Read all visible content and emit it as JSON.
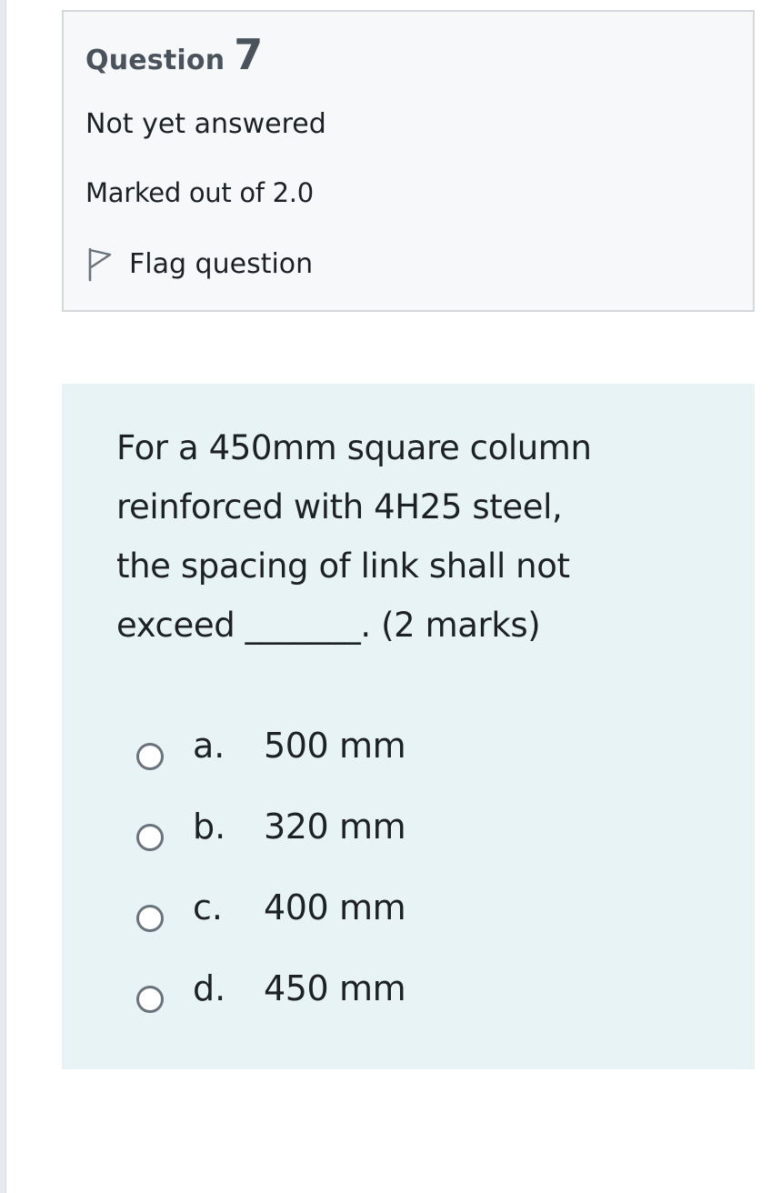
{
  "question": {
    "label": "Question",
    "number": "7",
    "state": "Not yet answered",
    "grade": "Marked out of 2.0",
    "flag_label": "Flag question",
    "flag_icon": "flag-outline-icon"
  },
  "content": {
    "lines": [
      "For a 450mm square column",
      "reinforced with 4H25 steel,",
      "the spacing of link shall not",
      "exceed _______. (2 marks)"
    ],
    "answers": [
      {
        "letter": "a.",
        "text": "500 mm",
        "selected": false
      },
      {
        "letter": "b.",
        "text": "320 mm",
        "selected": false
      },
      {
        "letter": "c.",
        "text": "400 mm",
        "selected": false
      },
      {
        "letter": "d.",
        "text": "450 mm",
        "selected": false
      }
    ]
  },
  "colors": {
    "info_background": "#f7f8fa",
    "info_border": "#d3d8dd",
    "question_background": "#e7f3f5",
    "text": "#1d2125",
    "heading_text": "#4a535b",
    "radio_border": "#6a737b"
  }
}
